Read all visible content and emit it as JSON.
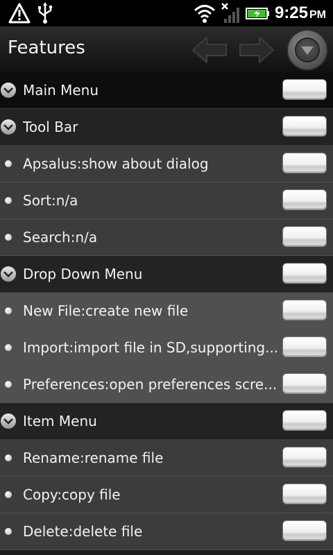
{
  "status_bar": {
    "time": "9:25",
    "ampm": "PM",
    "icons": [
      "warning-icon",
      "usb-icon",
      "wifi-icon",
      "signal-no-service-icon",
      "battery-charging-icon"
    ]
  },
  "title_bar": {
    "title": "Features",
    "back_icon": "arrow-left-icon",
    "forward_icon": "arrow-right-icon",
    "menu_icon": "dropdown-menu-icon"
  },
  "rows": [
    {
      "type": "section",
      "label": "Main Menu"
    },
    {
      "type": "section",
      "label": "Tool Bar"
    },
    {
      "type": "item",
      "label": "Apsalus:show about dialog"
    },
    {
      "type": "item",
      "label": "Sort:n/a"
    },
    {
      "type": "item",
      "label": "Search:n/a"
    },
    {
      "type": "section",
      "label": "Drop Down Menu"
    },
    {
      "type": "item",
      "label": "New File:create new file"
    },
    {
      "type": "item",
      "label": "Import:import file in SD,supporting..."
    },
    {
      "type": "item",
      "label": "Preferences:open preferences scre..."
    },
    {
      "type": "section",
      "label": "Item Menu"
    },
    {
      "type": "item",
      "label": "Rename:rename file"
    },
    {
      "type": "item",
      "label": "Copy:copy file"
    },
    {
      "type": "item",
      "label": "Delete:delete file"
    }
  ]
}
